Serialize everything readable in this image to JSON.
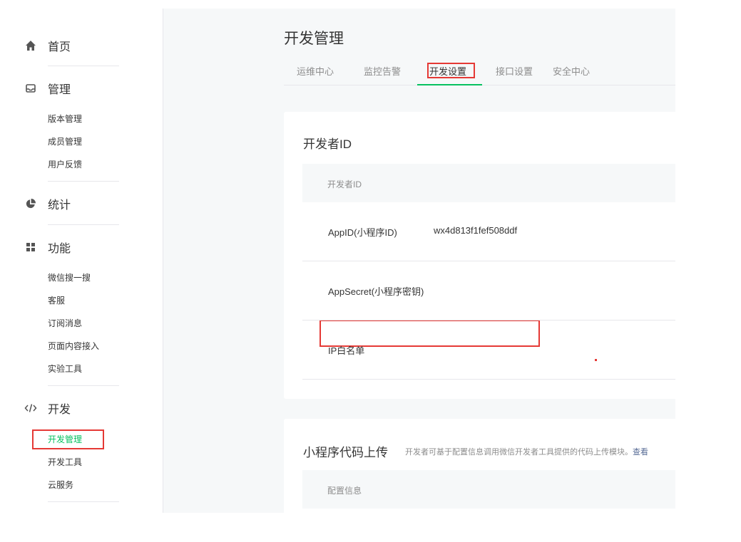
{
  "sidebar": {
    "home": {
      "label": "首页",
      "icon": "home-icon"
    },
    "manage": {
      "label": "管理",
      "icon": "inbox-icon",
      "items": [
        "版本管理",
        "成员管理",
        "用户反馈"
      ]
    },
    "stats": {
      "label": "统计",
      "icon": "pie-chart-icon"
    },
    "features": {
      "label": "功能",
      "icon": "grid-icon",
      "items": [
        "微信搜一搜",
        "客服",
        "订阅消息",
        "页面内容接入",
        "实验工具"
      ]
    },
    "dev": {
      "label": "开发",
      "icon": "code-icon",
      "items": [
        "开发管理",
        "开发工具",
        "云服务"
      ],
      "active_item": "开发管理"
    }
  },
  "main": {
    "title": "开发管理",
    "tabs": [
      "运维中心",
      "监控告警",
      "开发设置",
      "接口设置",
      "安全中心"
    ],
    "active_tab": "开发设置",
    "dev_id_card": {
      "title": "开发者ID",
      "table_header": "开发者ID",
      "rows": [
        {
          "label": "AppID(小程序ID)",
          "value": "wx4d813f1fef508ddf"
        },
        {
          "label": "AppSecret(小程序密钥)",
          "value": ""
        },
        {
          "label": "IP白名单",
          "value": ""
        }
      ]
    },
    "upload_card": {
      "title": "小程序代码上传",
      "desc": "开发者可基于配置信息调用微信开发者工具提供的代码上传模块。",
      "desc_link": "查看",
      "table_header": "配置信息"
    }
  },
  "colors": {
    "accent": "#07c160",
    "highlight": "#e53935",
    "link": "#576b95"
  }
}
